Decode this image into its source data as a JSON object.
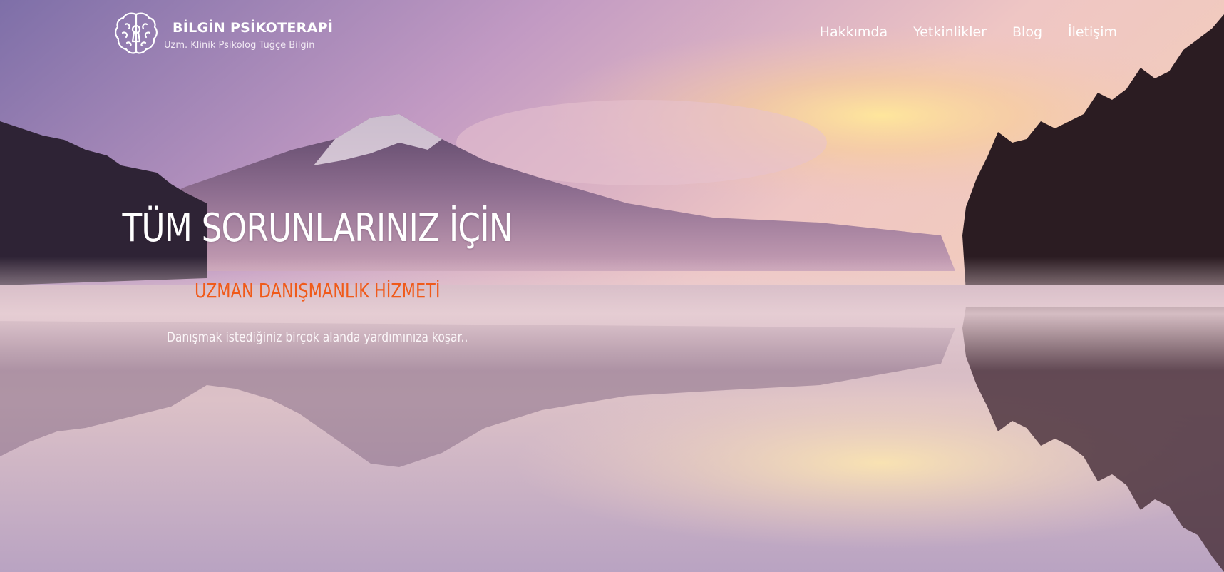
{
  "header": {
    "brand_title": "BİLGİN PSİKOTERAPİ",
    "brand_subtitle": "Uzm. Klinik Psikolog Tuğçe Bilgin",
    "logo_icon": "brain-keyhole-icon"
  },
  "nav": {
    "items": [
      {
        "label": "Hakkımda"
      },
      {
        "label": "Yetkinlikler"
      },
      {
        "label": "Blog"
      },
      {
        "label": "İletişim"
      }
    ]
  },
  "hero": {
    "headline": "TÜM SORUNLARINIZ İÇİN",
    "subheadline": "UZMAN DANIŞMANLIK HİZMETİ",
    "tagline": "Danışmak istediğiniz birçok alanda yardımınıza koşar..",
    "background": "misty mountain lake at sunrise"
  },
  "colors": {
    "accent": "#f05a1a",
    "text": "#ffffff"
  }
}
